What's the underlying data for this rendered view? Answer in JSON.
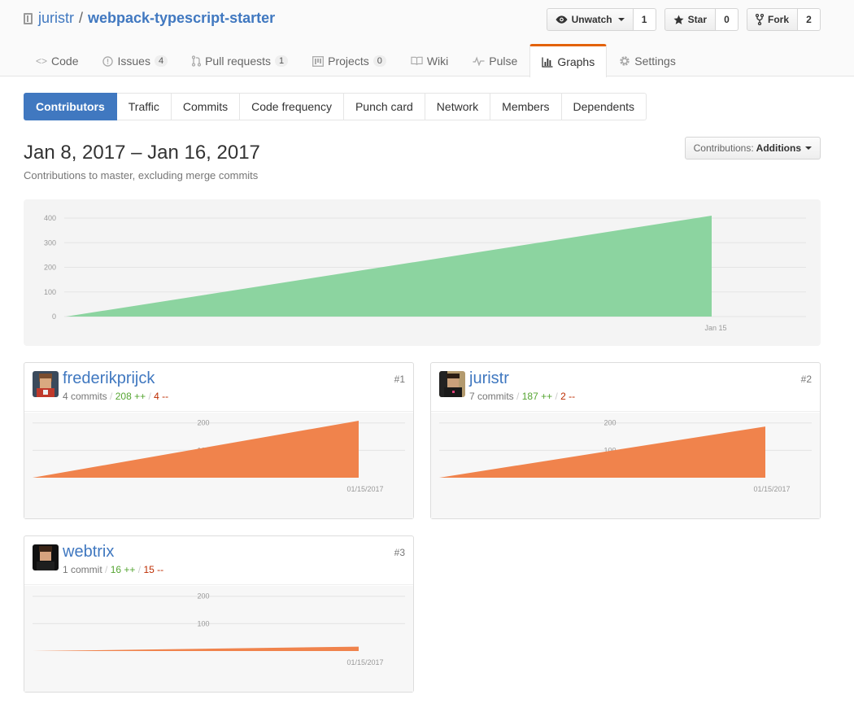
{
  "repo": {
    "owner": "juristr",
    "separator": "/",
    "name": "webpack-typescript-starter"
  },
  "actions": {
    "watch": {
      "label": "Unwatch",
      "count": "1"
    },
    "star": {
      "label": "Star",
      "count": "0"
    },
    "fork": {
      "label": "Fork",
      "count": "2"
    }
  },
  "nav": [
    {
      "label": "Code",
      "icon": "code-icon"
    },
    {
      "label": "Issues",
      "count": "4",
      "icon": "issue-icon"
    },
    {
      "label": "Pull requests",
      "count": "1",
      "icon": "pull-request-icon"
    },
    {
      "label": "Projects",
      "count": "0",
      "icon": "project-icon"
    },
    {
      "label": "Wiki",
      "icon": "book-icon"
    },
    {
      "label": "Pulse",
      "icon": "pulse-icon"
    },
    {
      "label": "Graphs",
      "icon": "graph-icon",
      "selected": true
    },
    {
      "label": "Settings",
      "icon": "gear-icon"
    }
  ],
  "subnav": [
    "Contributors",
    "Traffic",
    "Commits",
    "Code frequency",
    "Punch card",
    "Network",
    "Members",
    "Dependents"
  ],
  "header": {
    "date_range": "Jan 8, 2017 – Jan 16, 2017",
    "subtitle": "Contributions to master, excluding merge commits",
    "contrib_prefix": "Contributions:",
    "contrib_value": "Additions"
  },
  "colors": {
    "main_area": "#8cd4a0",
    "contributor_area": "#f0834c",
    "accent": "#4078c0",
    "selected_tab": "#e36209"
  },
  "chart_data": [
    {
      "type": "area",
      "x": [
        "Jan 8, 2017",
        "Jan 15, 2017"
      ],
      "y": [
        0,
        410
      ],
      "x_tick_labels": [
        "Jan 15"
      ],
      "y_ticks": [
        0,
        100,
        200,
        300,
        400
      ],
      "ylim": [
        0,
        410
      ]
    },
    {
      "type": "area",
      "x": [
        "Jan 8, 2017",
        "01/15/2017"
      ],
      "y": [
        0,
        208
      ],
      "x_tick_labels": [
        "01/15/2017"
      ],
      "y_ticks": [
        100,
        200
      ],
      "ylim": [
        0,
        208
      ]
    },
    {
      "type": "area",
      "x": [
        "Jan 8, 2017",
        "01/15/2017"
      ],
      "y": [
        0,
        187
      ],
      "x_tick_labels": [
        "01/15/2017"
      ],
      "y_ticks": [
        100,
        200
      ],
      "ylim": [
        0,
        208
      ]
    },
    {
      "type": "area",
      "x": [
        "Jan 8, 2017",
        "01/15/2017"
      ],
      "y": [
        0,
        16
      ],
      "x_tick_labels": [
        "01/15/2017"
      ],
      "y_ticks": [
        100,
        200
      ],
      "ylim": [
        0,
        208
      ]
    }
  ],
  "contributors": [
    {
      "name": "frederikprijck",
      "commits": "4 commits",
      "additions": "208 ++",
      "deletions": "4 --",
      "rank": "#1"
    },
    {
      "name": "juristr",
      "commits": "7 commits",
      "additions": "187 ++",
      "deletions": "2 --",
      "rank": "#2"
    },
    {
      "name": "webtrix",
      "commits": "1 commit",
      "additions": "16 ++",
      "deletions": "15 --",
      "rank": "#3"
    }
  ]
}
